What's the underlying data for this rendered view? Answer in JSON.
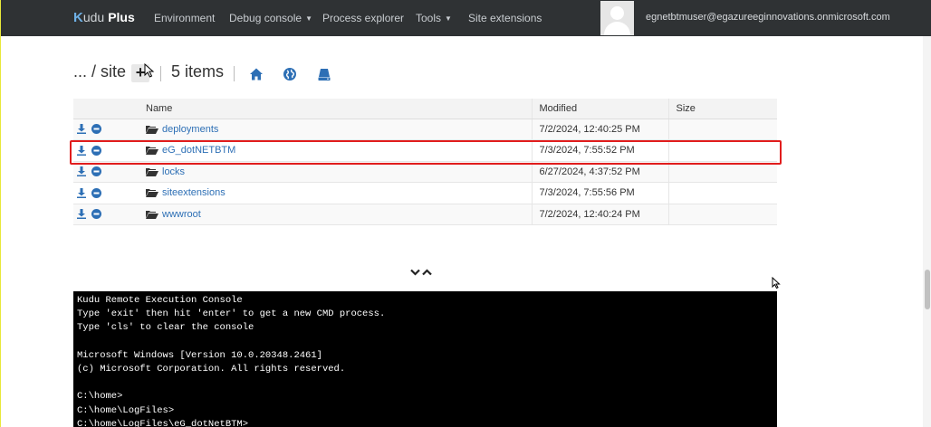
{
  "navbar": {
    "brand_k": "K",
    "brand_udu": "udu",
    "brand_plus": "Plus",
    "links": [
      "Environment",
      "Debug console",
      "Process explorer",
      "Tools",
      "Site extensions"
    ],
    "user_email": "egnetbtmuser@egazureeginnovations.onmicrosoft.com"
  },
  "breadcrumb": {
    "path": "... / site",
    "add_label": "+",
    "item_count": "5 items"
  },
  "table": {
    "headers": {
      "name": "Name",
      "modified": "Modified",
      "size": "Size"
    },
    "rows": [
      {
        "name": "deployments",
        "modified": "7/2/2024, 12:40:25 PM",
        "size": ""
      },
      {
        "name": "eG_dotNETBTM",
        "modified": "7/3/2024, 7:55:52 PM",
        "size": ""
      },
      {
        "name": "locks",
        "modified": "6/27/2024, 4:37:52 PM",
        "size": ""
      },
      {
        "name": "siteextensions",
        "modified": "7/3/2024, 7:55:56 PM",
        "size": ""
      },
      {
        "name": "wwwroot",
        "modified": "7/2/2024, 12:40:24 PM",
        "size": ""
      }
    ]
  },
  "console": {
    "lines": [
      "Kudu Remote Execution Console",
      "Type 'exit' then hit 'enter' to get a new CMD process.",
      "Type 'cls' to clear the console",
      "",
      "Microsoft Windows [Version 10.0.20348.2461]",
      "(c) Microsoft Corporation. All rights reserved.",
      "",
      "C:\\home>",
      "C:\\home\\LogFiles>",
      "C:\\home\\LogFiles\\eG_dotNetBTM>"
    ]
  },
  "icons": {
    "home": "home-icon",
    "globe": "globe-icon",
    "drive": "drive-icon",
    "download": "download-icon",
    "remove": "remove-icon",
    "folder": "folder-icon"
  },
  "colors": {
    "navbar": "#2f3234",
    "link": "#2d6fb5",
    "highlight": "#e11d1d",
    "console_bg": "#000000"
  }
}
